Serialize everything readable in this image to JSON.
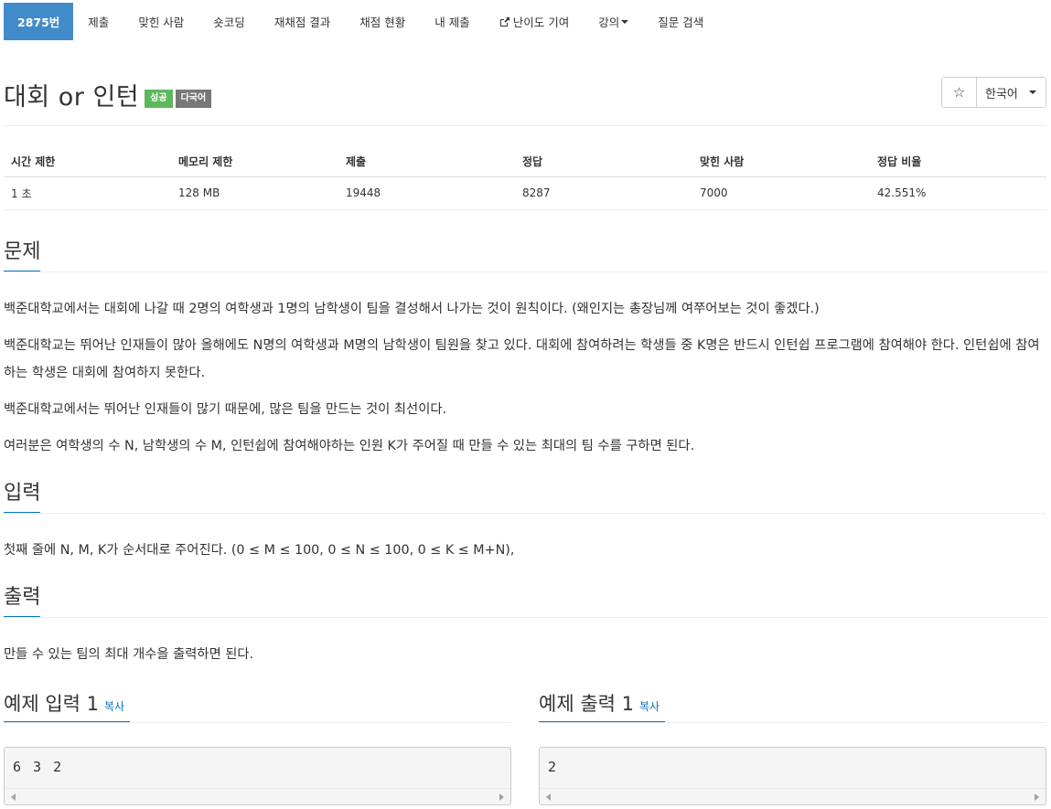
{
  "nav": {
    "items": [
      {
        "label": "2875번"
      },
      {
        "label": "제출"
      },
      {
        "label": "맞힌 사람"
      },
      {
        "label": "숏코딩"
      },
      {
        "label": "재채점 결과"
      },
      {
        "label": "채점 현황"
      },
      {
        "label": "내 제출"
      },
      {
        "label": "난이도 기여",
        "icon": "external-link-icon"
      },
      {
        "label": "강의",
        "icon": "caret-down-icon"
      },
      {
        "label": "질문 검색"
      }
    ]
  },
  "problem": {
    "title": "대회 or 인턴",
    "badge_status": "성공",
    "badge_lang": "다국어",
    "star": "☆",
    "language": "한국어"
  },
  "colors": {
    "nav_active": "#428bca",
    "badge_success": "#5cb85c",
    "badge_default": "#777777",
    "accent": "#0076c0"
  },
  "info": {
    "headers": [
      "시간 제한",
      "메모리 제한",
      "제출",
      "정답",
      "맞힌 사람",
      "정답 비율"
    ],
    "values": [
      "1 초",
      "128 MB",
      "19448",
      "8287",
      "7000",
      "42.551%"
    ]
  },
  "sections": {
    "problem_title": "문제",
    "problem_paras": [
      "백준대학교에서는 대회에 나갈 때 2명의 여학생과 1명의 남학생이 팀을 결성해서 나가는 것이 원칙이다. (왜인지는 총장님께 여쭈어보는 것이 좋겠다.)",
      "백준대학교는 뛰어난 인재들이 많아 올해에도 N명의 여학생과 M명의 남학생이 팀원을 찾고 있다. 대회에 참여하려는 학생들 중 K명은 반드시 인턴쉽 프로그램에 참여해야 한다. 인턴쉽에 참여하는 학생은 대회에 참여하지 못한다.",
      "백준대학교에서는 뛰어난 인재들이 많기 때문에, 많은 팀을 만드는 것이 최선이다.",
      "여러분은 여학생의 수 N, 남학생의 수 M, 인턴쉽에 참여해야하는 인원 K가 주어질 때 만들 수 있는 최대의 팀 수를 구하면 된다."
    ],
    "input_title": "입력",
    "input_text": "첫째 줄에 N, M, K가 순서대로 주어진다. (0 ≤ M ≤ 100, 0 ≤ N ≤ 100, 0 ≤ K ≤ M+N),",
    "output_title": "출력",
    "output_text": "만들 수 있는 팀의 최대 개수을 출력하면 된다."
  },
  "samples": {
    "input_title": "예제 입력 1",
    "output_title": "예제 출력 1",
    "copy_label": "복사",
    "input_value": "6 3 2",
    "output_value": "2"
  }
}
